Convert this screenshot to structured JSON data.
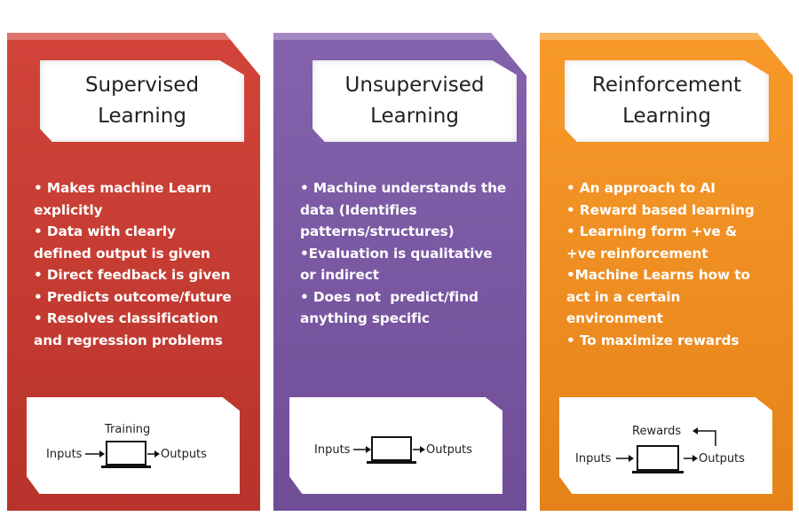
{
  "panels": [
    {
      "color": "#c23a32",
      "title_line1": "Supervised",
      "title_line2": "Learning",
      "bullets": [
        "• Makes machine Learn",
        "explicitly",
        "• Data with clearly",
        "defined output is given",
        "• Direct feedback is given",
        "• Predicts outcome/future",
        "• Resolves classification",
        "and regression problems"
      ],
      "diagram": {
        "top_label": "Training",
        "input": "Inputs",
        "output": "Outputs"
      }
    },
    {
      "color": "#7b57a3",
      "title_line1": "Unsupervised",
      "title_line2": "Learning",
      "bullets": [
        "• Machine understands the",
        "data (Identifies",
        "patterns/structures)",
        "•Evaluation is qualitative",
        "or indirect",
        "• Does not  predict/find",
        "anything specific"
      ],
      "diagram": {
        "input": "Inputs",
        "output": "Outputs"
      }
    },
    {
      "color": "#f2901f",
      "title_line1": "Reinforcement",
      "title_line2": "Learning",
      "bullets": [
        "• An approach to AI",
        "• Reward based learning",
        "• Learning form +ve &",
        "+ve reinforcement",
        "•Machine Learns how to",
        "act in a certain",
        "environment",
        "• To maximize rewards"
      ],
      "diagram": {
        "top_label": "Rewards",
        "input": "Inputs",
        "output": "Outputs"
      }
    }
  ]
}
